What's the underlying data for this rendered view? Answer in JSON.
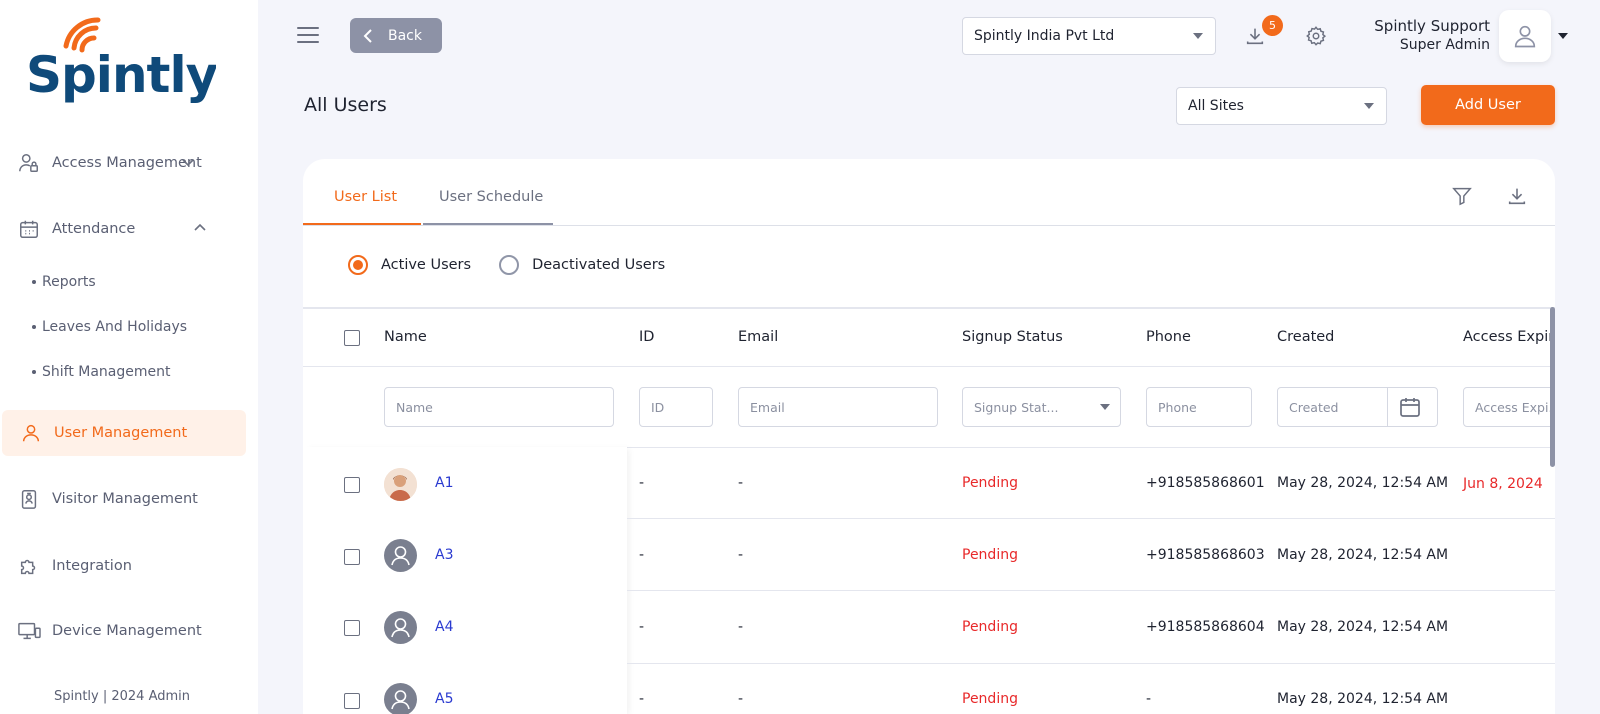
{
  "brand": {
    "name": "Spintly",
    "accent": "#f26a1b",
    "logo_blue": "#0f4a7a"
  },
  "sidebar": {
    "items": [
      {
        "label": "Access Management",
        "icon": "user-lock-icon"
      },
      {
        "label": "Attendance",
        "icon": "calendar-icon"
      },
      {
        "label": "User Management",
        "icon": "user-icon"
      },
      {
        "label": "Visitor Management",
        "icon": "badge-icon"
      },
      {
        "label": "Integration",
        "icon": "puzzle-icon"
      },
      {
        "label": "Device Management",
        "icon": "devices-icon"
      }
    ],
    "attendance_sub": [
      "Reports",
      "Leaves And Holidays",
      "Shift Management"
    ],
    "footer": "Spintly | 2024 Admin"
  },
  "topbar": {
    "back_label": "Back",
    "org_select": "Spintly India Pvt Ltd",
    "download_badge": "5",
    "user_name": "Spintly Support",
    "user_role": "Super Admin"
  },
  "page": {
    "title": "All Users",
    "site_select": "All Sites",
    "add_user_label": "Add User"
  },
  "tabs": [
    "User List",
    "User Schedule"
  ],
  "filters_radio": {
    "active": "Active Users",
    "deactivated": "Deactivated Users"
  },
  "table": {
    "columns": [
      "Name",
      "ID",
      "Email",
      "Signup Status",
      "Phone",
      "Created",
      "Access Expir"
    ],
    "filter_placeholders": {
      "name": "Name",
      "id": "ID",
      "email": "Email",
      "signup": "Signup Stat...",
      "phone": "Phone",
      "created": "Created",
      "expiry": "Access Expi..."
    },
    "rows": [
      {
        "name": "A1",
        "id": "-",
        "email": "-",
        "signup": "Pending",
        "phone": "+918585868601",
        "created": "May 28, 2024, 12:54 AM",
        "expiry": "Jun 8, 2024",
        "avatar": "photo"
      },
      {
        "name": "A3",
        "id": "-",
        "email": "-",
        "signup": "Pending",
        "phone": "+918585868603",
        "created": "May 28, 2024, 12:54 AM",
        "expiry": "",
        "avatar": "default"
      },
      {
        "name": "A4",
        "id": "-",
        "email": "-",
        "signup": "Pending",
        "phone": "+918585868604",
        "created": "May 28, 2024, 12:54 AM",
        "expiry": "",
        "avatar": "default"
      },
      {
        "name": "A5",
        "id": "-",
        "email": "-",
        "signup": "Pending",
        "phone": "-",
        "created": "May 28, 2024, 12:54 AM",
        "expiry": "",
        "avatar": "default"
      }
    ]
  }
}
